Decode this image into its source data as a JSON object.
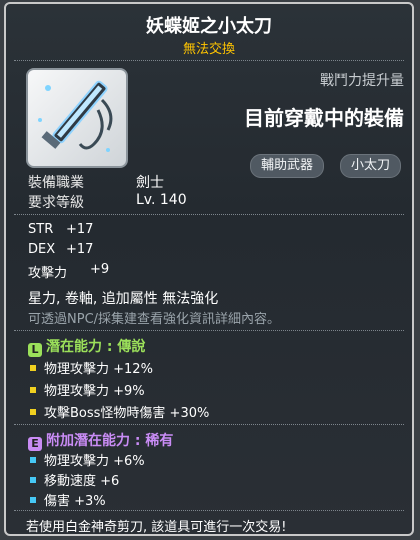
{
  "item": {
    "name": "妖蝶姬之小太刀",
    "trade_status": "無法交換"
  },
  "header": {
    "combat_power_label": "戰鬥力提升量",
    "equipped_status": "目前穿戴中的裝備",
    "tags": [
      "輔助武器",
      "小太刀"
    ]
  },
  "requirements": [
    {
      "label": "裝備職業",
      "value": "劍士"
    },
    {
      "label": "要求等級",
      "value": "Lv. 140"
    }
  ],
  "stats": [
    {
      "name": "STR",
      "value": "+17"
    },
    {
      "name": "DEX",
      "value": "+17"
    },
    {
      "name": "攻擊力",
      "value": "+9"
    }
  ],
  "properties": "星力, 卷軸, 追加屬性 無法強化",
  "enhance_hint": "可透過NPC/採集建查看強化資訊詳細內容。",
  "potential": {
    "label": "潛在能力 : 傳說",
    "badge": "L",
    "color": "#9be05a",
    "lines": [
      {
        "text": "物理攻擊力 +12%",
        "dot_color": "#f0d020"
      },
      {
        "text": "物理攻擊力 +9%",
        "dot_color": "#f0d020"
      },
      {
        "text": "攻擊Boss怪物時傷害 +30%",
        "dot_color": "#f0d020"
      }
    ]
  },
  "additional_potential": {
    "label": "附加潛在能力 : 稀有",
    "badge": "E",
    "color": "#c98cf5",
    "lines": [
      {
        "text": "物理攻擊力 +6%",
        "dot_color": "#46c8f5"
      },
      {
        "text": "移動速度 +6",
        "dot_color": "#46c8f5"
      },
      {
        "text": "傷害 +3%",
        "dot_color": "#46c8f5"
      }
    ]
  },
  "footer": "若使用白金神奇剪刀, 該道具可進行一次交易!"
}
